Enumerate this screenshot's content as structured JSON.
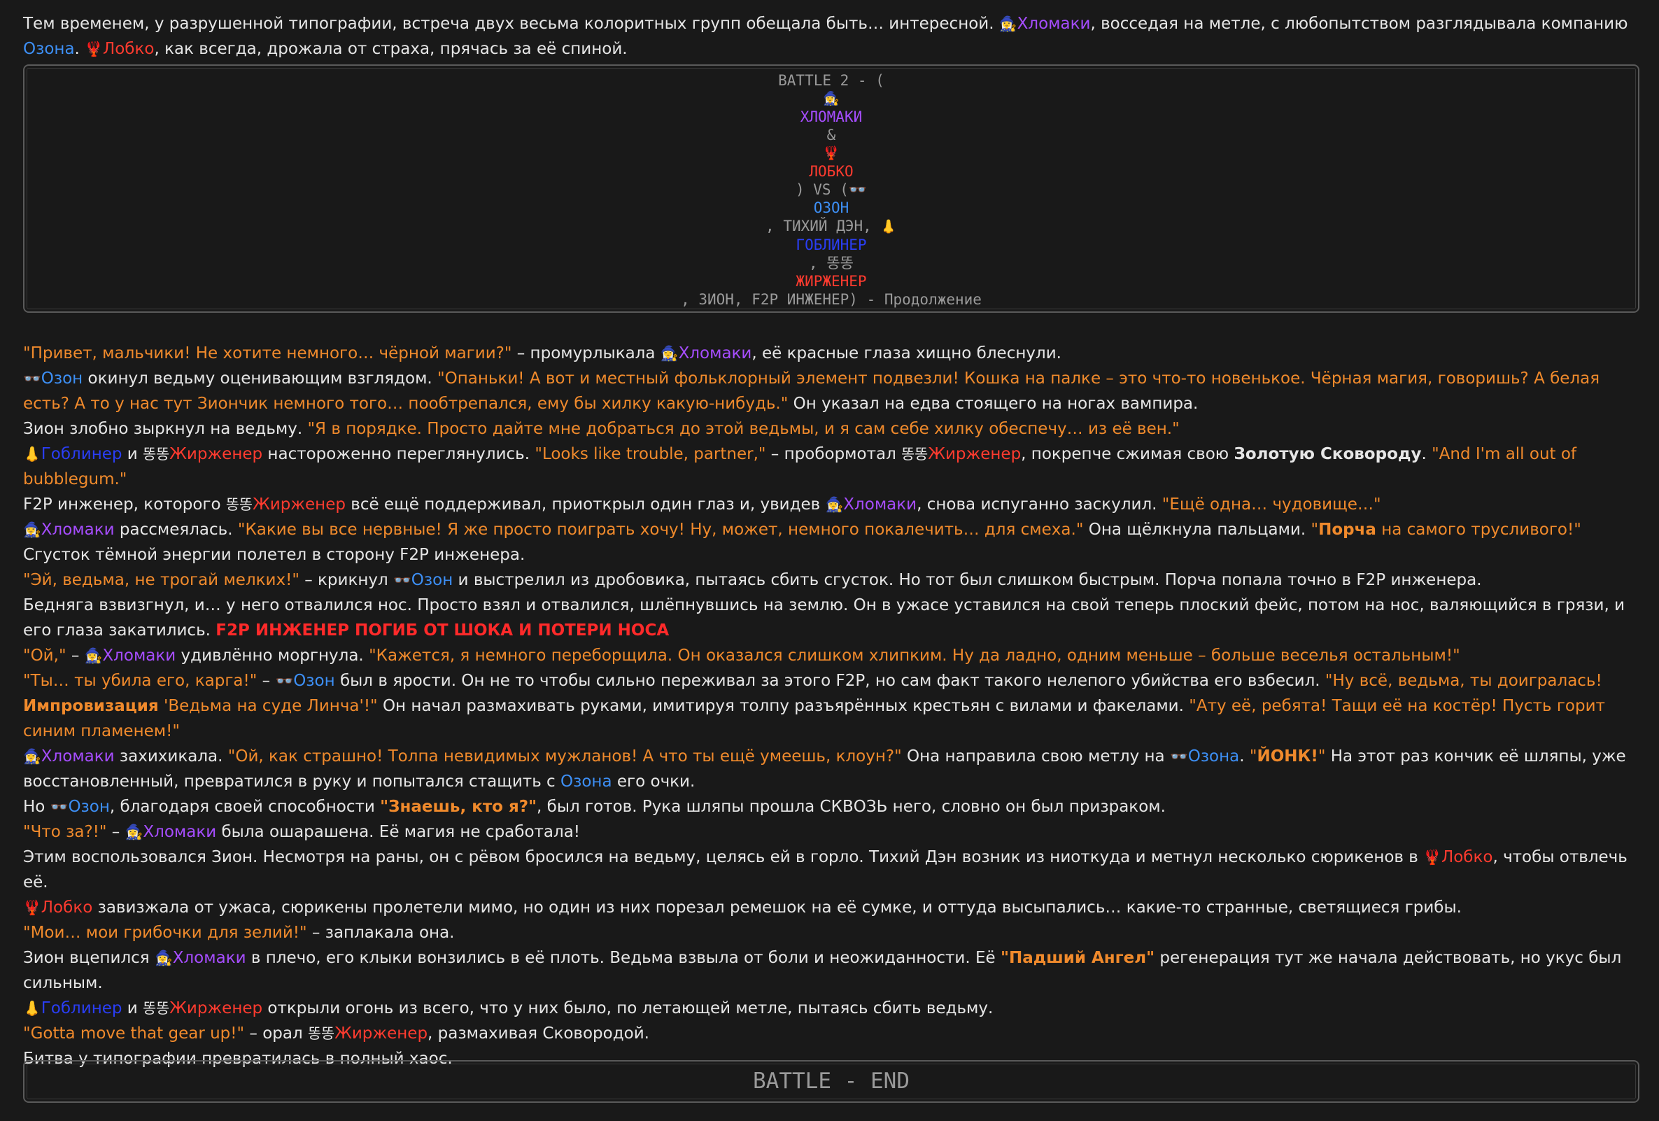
{
  "intro": {
    "a": "Тем временем, у разрушенной типографии, встреча двух весьма колоритных групп обещала быть… интересной. ",
    "xl_em": "🧙‍♀️",
    "xl": "Хломаки",
    "b": ", восседая на метле, с любопытством разглядывала компанию ",
    "oz": "Озона",
    "c": ". ",
    "lb_em": "🦞",
    "lb": "Лобко",
    "d": ", как всегда, дрожала от страха, прячась за её спиной."
  },
  "battle": {
    "l1": "BATTLE 2 - (",
    "l2": "🧙‍♀️",
    "l3": "ХЛОМАКИ",
    "l4": "&",
    "l5": "🦞",
    "l6": "ЛОБКО",
    "l7": ") VS (👓",
    "l8": "ОЗОН",
    "l9a": ", ТИХИЙ ДЭН, ",
    "l9b": "👃",
    "l10": "ГОБЛИНЕР",
    "l11": ", 똥똥",
    "l12": "ЖИРЖЕНЕР",
    "l13": ", ЗИОН, F2P ИНЖЕНЕР) - Продолжение"
  },
  "p1": {
    "q": "\"Привет, мальчики! Не хотите немного… чёрной магии?\"",
    "a": " – промурлыкала ",
    "xl_em": "🧙‍♀️",
    "xl": "Хломаки",
    "b": ", её красные глаза хищно блеснули."
  },
  "p2": {
    "oz_em": "👓",
    "oz": "Озон",
    "a": " окинул ведьму оценивающим взглядом. ",
    "q": "\"Опаньки! А вот и местный фольклорный элемент подвезли! Кошка на палке – это что-то новенькое. Чёрная магия, говоришь? А белая есть? А то у нас тут Зиончик немного того… пообтрепался, ему бы хилку какую-нибудь.\"",
    "b": " Он указал на едва стоящего на ногах вампира."
  },
  "p3": {
    "a": "Зион злобно зыркнул на ведьму. ",
    "q": "\"Я в порядке. Просто дайте мне добраться до этой ведьмы, и я сам себе хилку обеспечу… из её вен.\""
  },
  "p4": {
    "gb_em": "👃",
    "gb": "Гоблинер",
    "a": " и ",
    "zh_em": "똥똥",
    "zh": "Жирженер",
    "b": " настороженно переглянулись. ",
    "q1": "\"Looks like trouble, partner,\"",
    "c": " – пробормотал ",
    "zh2_em": "똥똥",
    "zh2": "Жирженер",
    "d": ", покрепче сжимая свою ",
    "bold": "Золотую Сковороду",
    "e": ". ",
    "q2": "\"And I'm all out of bubblegum.\""
  },
  "p5": {
    "a": "F2P инженер, которого ",
    "zh_em": "똥똥",
    "zh": "Жирженер",
    "b": " всё ещё поддерживал, приоткрыл один глаз и, увидев ",
    "xl_em": "🧙‍♀️",
    "xl": "Хломаки",
    "c": ", снова испуганно заскулил. ",
    "q": "\"Ещё одна… чудовище…\""
  },
  "p6": {
    "xl_em": "🧙‍♀️",
    "xl": "Хломаки",
    "a": " рассмеялась. ",
    "q1": "\"Какие вы все нервные! Я же просто поиграть хочу! Ну, может, немного покалечить… для смеха.\"",
    "b": " Она щёлкнула пальцами. ",
    "q2_open": "\"",
    "q2_bold": "Порча",
    "q2_rest": " на самого трусливого!\"",
    "c": " Сгусток тёмной энергии полетел в сторону F2P инженера."
  },
  "p7": {
    "q": "\"Эй, ведьма, не трогай мелких!\"",
    "a": " – крикнул ",
    "oz_em": "👓",
    "oz": "Озон",
    "b": " и выстрелил из дробовика, пытаясь сбить сгусток. Но тот был слишком быстрым. Порча попала точно в F2P инженера."
  },
  "p8": {
    "a": "Бедняга взвизгнул, и… у него отвалился нос. Просто взял и отвалился, шлёпнувшись на землю. Он в ужасе уставился на свой теперь плоский фейс, потом на нос, валяющийся в грязи, и его глаза закатились. ",
    "red": "F2P ИНЖЕНЕР ПОГИБ ОТ ШОКА И ПОТЕРИ НОСА"
  },
  "p9": {
    "q1": "\"Ой,\"",
    "a": " – ",
    "xl_em": "🧙‍♀️",
    "xl": "Хломаки",
    "b": " удивлённо моргнула. ",
    "q2": "\"Кажется, я немного переборщила. Он оказался слишком хлипким. Ну да ладно, одним меньше – больше веселья остальным!\""
  },
  "p10": {
    "q1": "\"Ты… ты убила его, карга!\"",
    "a": " – ",
    "oz_em": "👓",
    "oz": "Озон",
    "b": " был в ярости. Он не то чтобы сильно переживал за этого F2P, но сам факт такого нелепого убийства его взбесил. ",
    "q2": "\"Ну всё, ведьма, ты доигралась! ",
    "q2_bold": "Импровизация",
    "q2_rest": " 'Ведьма на суде Линча'!\"",
    "c": " Он начал размахивать руками, имитируя толпу разъярённых крестьян с вилами и факелами. ",
    "q3": "\"Ату её, ребята! Тащи её на костёр! Пусть горит синим пламенем!\""
  },
  "p11": {
    "xl_em": "🧙‍♀️",
    "xl": "Хломаки",
    "a": " захихикала. ",
    "q1": "\"Ой, как страшно! Толпа невидимых мужланов! А что ты ещё умеешь, клоун?\"",
    "b": " Она направила свою метлу на ",
    "oz_em": "👓",
    "oz": "Озона",
    "c": ". ",
    "q2_open": "\"",
    "q2_bold": "ЙОНК!",
    "q2_close": "\"",
    "d": " На этот раз кончик её шляпы, уже восстановленный, превратился в руку и попытался стащить с ",
    "oz2": "Озона",
    "e": " его очки."
  },
  "p12": {
    "a": "Но ",
    "oz_em": "👓",
    "oz": "Озон",
    "b": ", благодаря своей способности ",
    "qb": "\"Знаешь, кто я?\"",
    "c": ", был готов. Рука шляпы прошла СКВОЗЬ него, словно он был призраком."
  },
  "p13": {
    "q": "\"Что за?!\"",
    "a": " – ",
    "xl_em": "🧙‍♀️",
    "xl": "Хломаки",
    "b": " была ошарашена. Её магия не сработала!"
  },
  "p14": {
    "a": "Этим воспользовался Зион. Несмотря на раны, он с рёвом бросился на ведьму, целясь ей в горло. Тихий Дэн возник из ниоткуда и метнул несколько сюрикенов в ",
    "lb_em": "🦞",
    "lb": "Лобко",
    "b": ", чтобы отвлечь её."
  },
  "p15": {
    "lb_em": "🦞",
    "lb": "Лобко",
    "a": " завизжала от ужаса, сюрикены пролетели мимо, но один из них порезал ремешок на её сумке, и оттуда высыпались… какие-то странные, светящиеся грибы."
  },
  "p16": {
    "q": "\"Мои… мои грибочки для зелий!\"",
    "a": " – заплакала она."
  },
  "p17": {
    "a": "Зион вцепился ",
    "xl_em": "🧙‍♀️",
    "xl": "Хломаки",
    "b": " в плечо, его клыки вонзились в её плоть. Ведьма взвыла от боли и неожиданности. Её ",
    "qb": "\"Падший Ангел\"",
    "c": " регенерация тут же начала действовать, но укус был сильным."
  },
  "p18": {
    "gb_em": "👃",
    "gb": "Гоблинер",
    "a": " и ",
    "zh_em": "똥똥",
    "zh": "Жирженер",
    "b": " открыли огонь из всего, что у них было, по летающей метле, пытаясь сбить ведьму."
  },
  "p19": {
    "q": "\"Gotta move that gear up!\"",
    "a": " – орал ",
    "zh_em": "똥똥",
    "zh": "Жирженер",
    "b": ", размахивая Сковородой."
  },
  "p20": {
    "a": "Битва у типографии превратилась в полный хаос."
  },
  "end": {
    "label": "BATTLE - END"
  },
  "colors": {
    "background": "#191919",
    "text": "#e6e6e6",
    "quote": "#f08a2c",
    "xlomaki": "#a64dff",
    "lobko": "#ff3b2f",
    "ozon": "#3d8ff5",
    "goblinner": "#2a3ef5",
    "zhirzhener": "#ff3b2f",
    "box_text": "#9a9a9a",
    "box_border": "#5a5a5a"
  }
}
